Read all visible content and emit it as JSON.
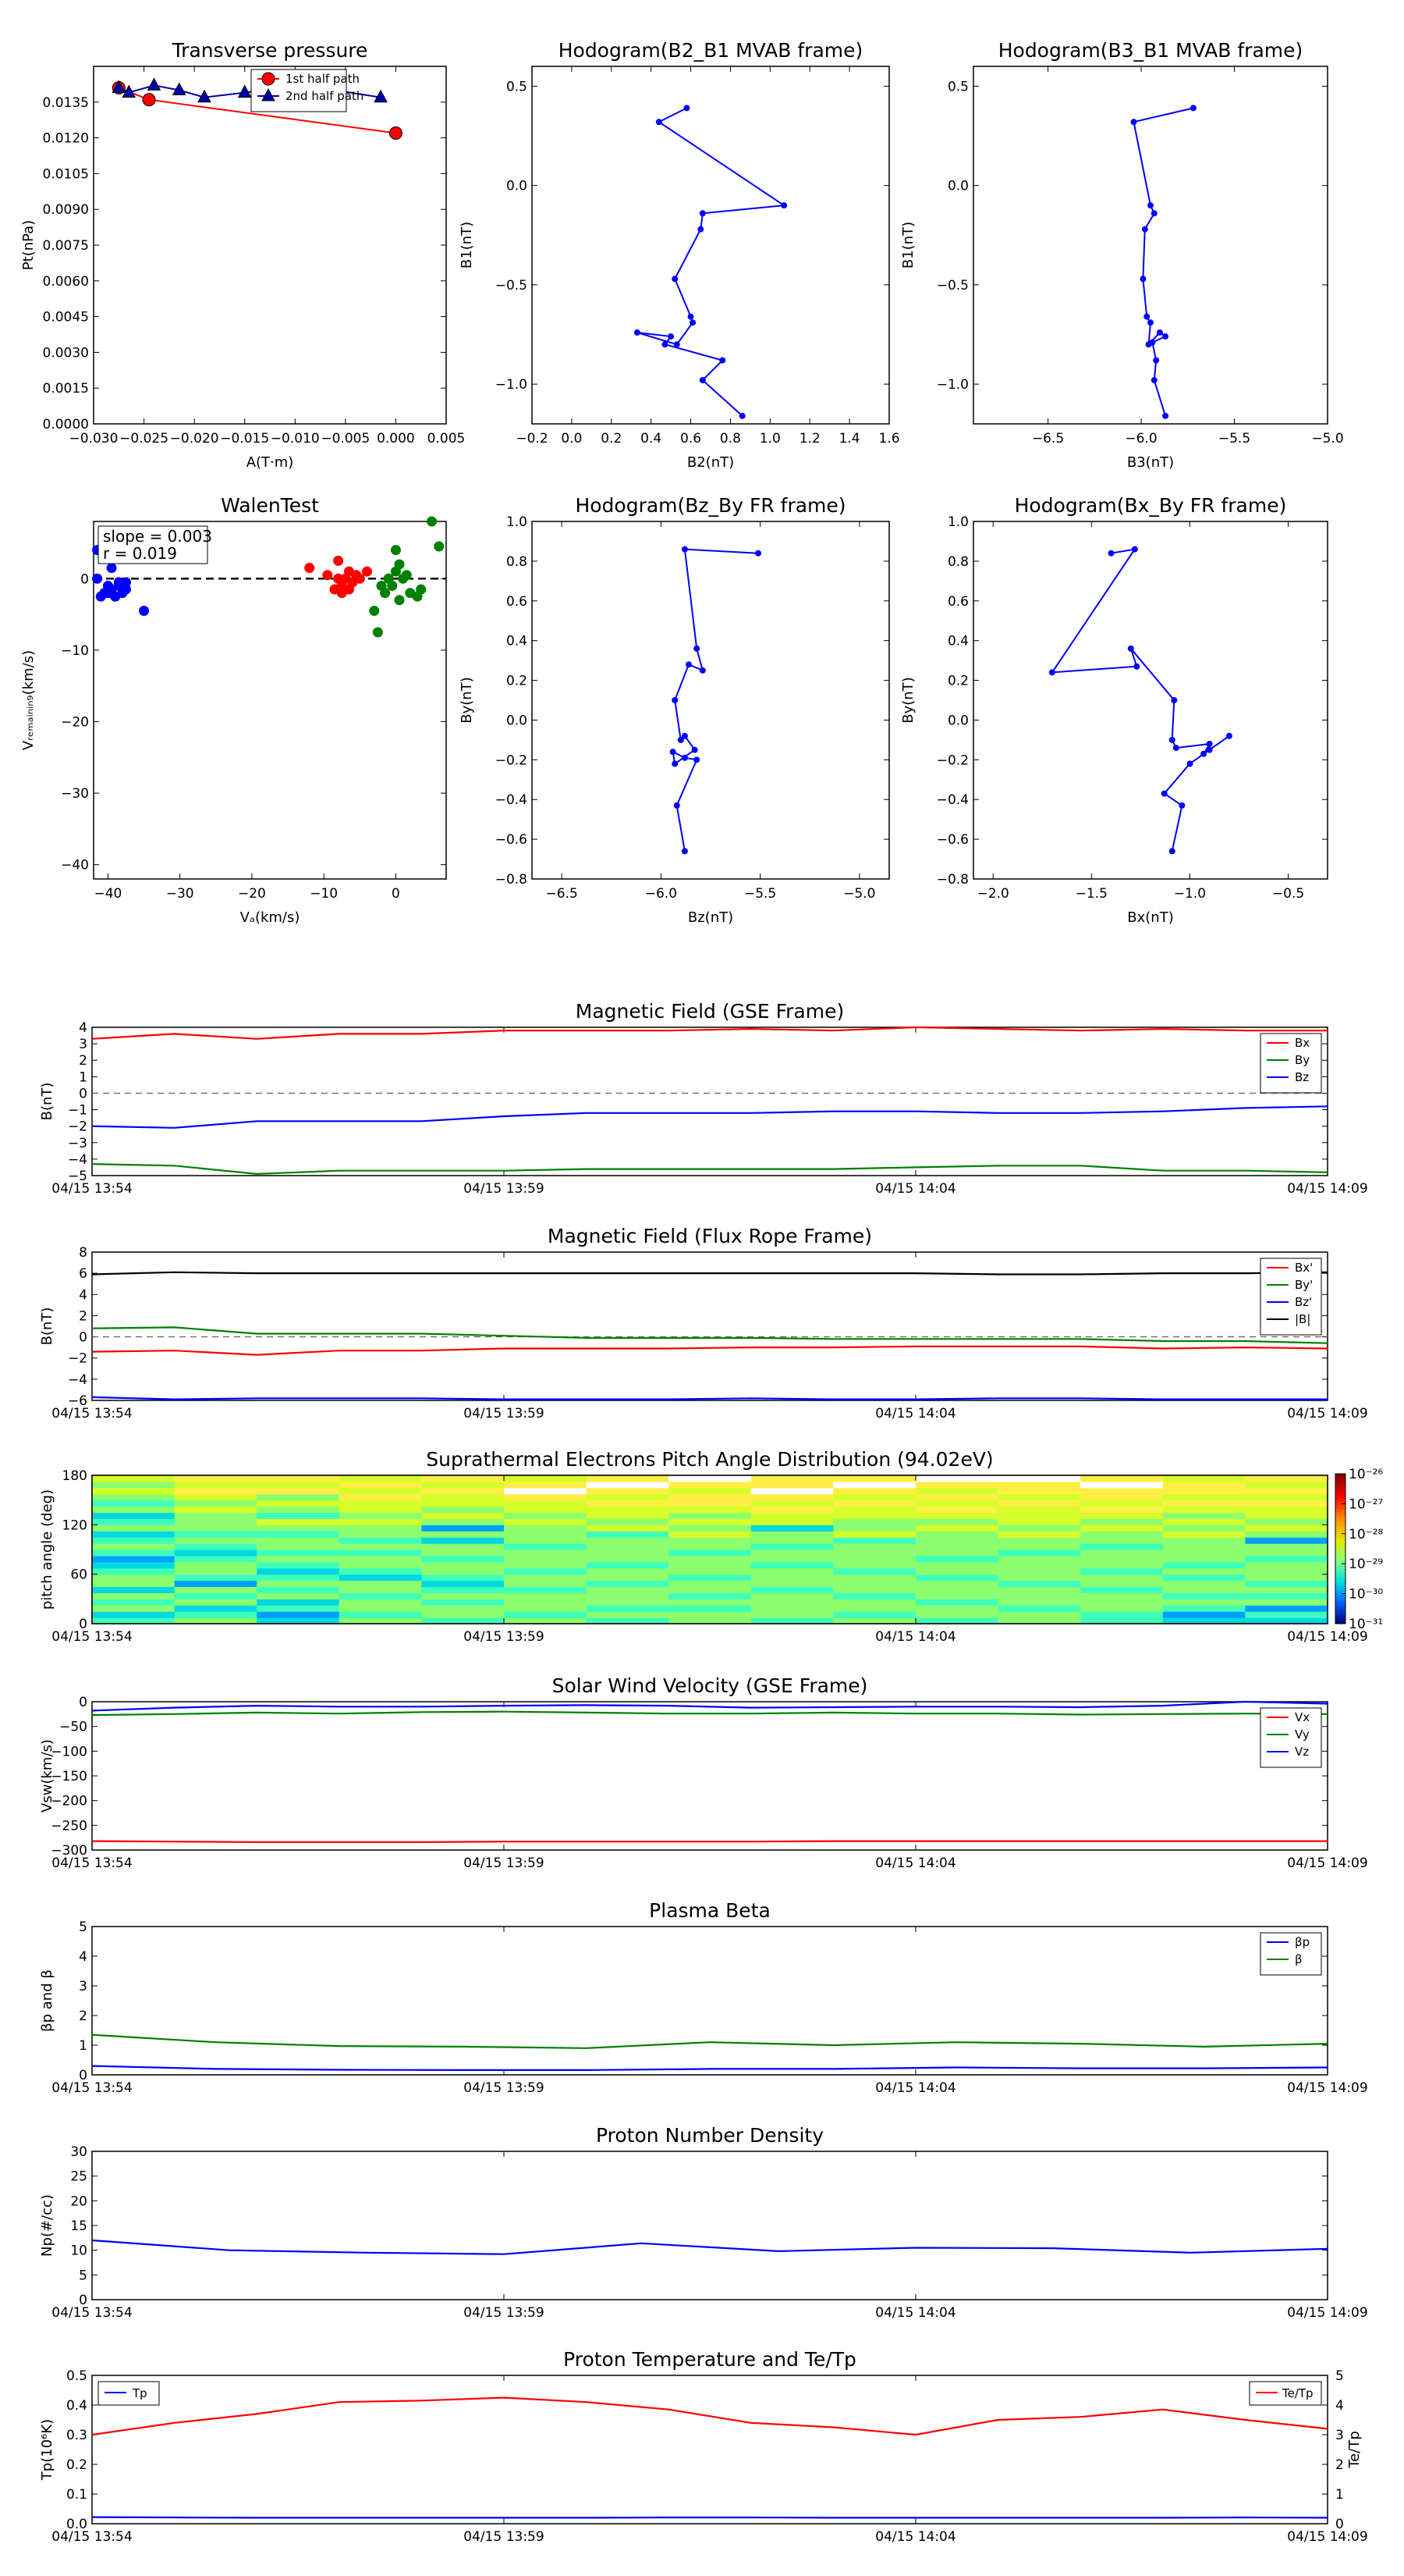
{
  "chart_data": [
    {
      "type": "line",
      "title": "Transverse pressure",
      "xlabel": "A(T·m)",
      "ylabel": "Pt(nPa)",
      "xlim": [
        -0.03,
        0.005
      ],
      "ylim": [
        0,
        0.015
      ],
      "xticks": [
        "−0.030",
        "−0.025",
        "−0.020",
        "−0.015",
        "−0.010",
        "−0.005",
        "0.000",
        "0.005"
      ],
      "yticks": [
        "0.0000",
        "0.0015",
        "0.0030",
        "0.0045",
        "0.0060",
        "0.0075",
        "0.0090",
        "0.0105",
        "0.0120",
        "0.0135"
      ],
      "legend": "top-right",
      "series": [
        {
          "name": "1st half path",
          "color": "#ff0000",
          "marker": "circle",
          "x": [
            0.0,
            -0.0245,
            -0.0275
          ],
          "y": [
            0.0122,
            0.0136,
            0.0141
          ]
        },
        {
          "name": "2nd half path",
          "color": "#0000aa",
          "marker": "triangle",
          "x": [
            -0.0275,
            -0.0265,
            -0.024,
            -0.0215,
            -0.019,
            -0.015,
            -0.0115,
            -0.0075,
            -0.0015
          ],
          "y": [
            0.0141,
            0.0139,
            0.0142,
            0.014,
            0.0137,
            0.0139,
            0.0141,
            0.0141,
            0.0137
          ]
        }
      ]
    },
    {
      "type": "line",
      "title": "Hodogram(B2_B1 MVAB frame)",
      "xlabel": "B2(nT)",
      "ylabel": "B1(nT)",
      "xlim": [
        -0.2,
        1.6
      ],
      "ylim": [
        -1.2,
        0.6
      ],
      "xticks": [
        "−0.2",
        "0.0",
        "0.2",
        "0.4",
        "0.6",
        "0.8",
        "1.0",
        "1.2",
        "1.4",
        "1.6"
      ],
      "yticks": [
        "−1.0",
        "−0.5",
        "0.0",
        "0.5"
      ],
      "series": [
        {
          "color": "#0000ff",
          "x": [
            0.58,
            0.44,
            1.07,
            0.66,
            0.65,
            0.52,
            0.6,
            0.61,
            0.53,
            0.33,
            0.5,
            0.47,
            0.76,
            0.66,
            0.86
          ],
          "y": [
            0.39,
            0.32,
            -0.1,
            -0.14,
            -0.22,
            -0.47,
            -0.66,
            -0.69,
            -0.8,
            -0.74,
            -0.76,
            -0.8,
            -0.88,
            -0.98,
            -1.16
          ]
        }
      ]
    },
    {
      "type": "line",
      "title": "Hodogram(B3_B1 MVAB frame)",
      "xlabel": "B3(nT)",
      "ylabel": "B1(nT)",
      "xlim": [
        -6.9,
        -5.0
      ],
      "ylim": [
        -1.2,
        0.6
      ],
      "xticks": [
        "−6.5",
        "−6.0",
        "−5.5",
        "−5.0"
      ],
      "yticks": [
        "−1.0",
        "−0.5",
        "0.0",
        "0.5"
      ],
      "series": [
        {
          "color": "#0000ff",
          "x": [
            -5.72,
            -6.04,
            -5.95,
            -5.93,
            -5.98,
            -5.99,
            -5.97,
            -5.95,
            -5.96,
            -5.9,
            -5.87,
            -5.94,
            -5.92,
            -5.93,
            -5.87
          ],
          "y": [
            0.39,
            0.32,
            -0.1,
            -0.14,
            -0.22,
            -0.47,
            -0.66,
            -0.69,
            -0.8,
            -0.74,
            -0.76,
            -0.79,
            -0.88,
            -0.98,
            -1.16
          ]
        }
      ]
    },
    {
      "type": "scatter",
      "title": "WalenTest",
      "xlabel": "Vₐ(km/s)",
      "ylabel": "Vᵣₑₘₐᵢₙᵢₙ₉(km/s)",
      "xlim": [
        -42,
        7
      ],
      "ylim": [
        -42,
        8
      ],
      "xticks": [
        "−40",
        "−30",
        "−20",
        "−10",
        "0"
      ],
      "yticks": [
        "−40",
        "−30",
        "−20",
        "−10",
        "0"
      ],
      "annotation": [
        "slope = 0.003",
        "r = 0.019"
      ],
      "series": [
        {
          "color": "#0000ff",
          "x": [
            -41.5,
            -40,
            -40,
            -39.5,
            -39,
            -38.5,
            -38,
            -37.5,
            -41,
            -40.5,
            -39.5,
            -38.5,
            -35,
            -40.5,
            -39,
            -37.5,
            -41.5
          ],
          "y": [
            0,
            -1,
            -2,
            -1.5,
            -2.5,
            -1,
            -2,
            -0.5,
            -2.5,
            -2,
            1.5,
            -0.5,
            -4.5,
            3,
            -2.5,
            -1.5,
            4
          ]
        },
        {
          "color": "#ff0000",
          "x": [
            -12,
            -9.5,
            -8,
            -7.5,
            -7,
            -6.5,
            -6,
            -5,
            -4,
            -8.5,
            -6.5,
            -7.5,
            -5.5,
            -8
          ],
          "y": [
            1.5,
            0.5,
            2.5,
            -1,
            0,
            1,
            -0.5,
            0,
            1,
            -1.5,
            -1.5,
            -2,
            0.5,
            0
          ]
        },
        {
          "color": "#008000",
          "x": [
            -3,
            -2.5,
            -1.5,
            -1,
            -0.5,
            0,
            0.5,
            1,
            2,
            3,
            3.5,
            5,
            6,
            -2,
            0,
            1.5,
            0.5,
            -1
          ],
          "y": [
            -4.5,
            -7.5,
            -2,
            0,
            -1,
            4,
            2,
            0,
            -2,
            -2.5,
            -1.5,
            8,
            4.5,
            -1,
            1,
            0.5,
            -3,
            0
          ]
        }
      ]
    },
    {
      "type": "line",
      "title": "Hodogram(Bz_By FR frame)",
      "xlabel": "Bz(nT)",
      "ylabel": "By(nT)",
      "xlim": [
        -6.65,
        -4.85
      ],
      "ylim": [
        -0.8,
        1.0
      ],
      "xticks": [
        "−6.5",
        "−6.0",
        "−5.5",
        "−5.0"
      ],
      "yticks": [
        "−0.8",
        "−0.6",
        "−0.4",
        "−0.2",
        "0.0",
        "0.2",
        "0.4",
        "0.6",
        "0.8",
        "1.0"
      ],
      "series": [
        {
          "color": "#0000ff",
          "x": [
            -5.51,
            -5.88,
            -5.82,
            -5.79,
            -5.86,
            -5.93,
            -5.9,
            -5.88,
            -5.83,
            -5.93,
            -5.94,
            -5.88,
            -5.82,
            -5.92,
            -5.88
          ],
          "y": [
            0.84,
            0.86,
            0.36,
            0.25,
            0.28,
            0.1,
            -0.1,
            -0.08,
            -0.15,
            -0.22,
            -0.16,
            -0.19,
            -0.2,
            -0.43,
            -0.66
          ]
        }
      ]
    },
    {
      "type": "line",
      "title": "Hodogram(Bx_By FR frame)",
      "xlabel": "Bx(nT)",
      "ylabel": "By(nT)",
      "xlim": [
        -2.1,
        -0.3
      ],
      "ylim": [
        -0.8,
        1.0
      ],
      "xticks": [
        "−2.0",
        "−1.5",
        "−1.0",
        "−0.5"
      ],
      "yticks": [
        "−0.8",
        "−0.6",
        "−0.4",
        "−0.2",
        "0.0",
        "0.2",
        "0.4",
        "0.6",
        "0.8",
        "1.0"
      ],
      "series": [
        {
          "color": "#0000ff",
          "x": [
            -1.4,
            -1.28,
            -1.7,
            -1.27,
            -1.3,
            -1.08,
            -1.09,
            -1.07,
            -0.9,
            -0.93,
            -0.8,
            -0.9,
            -1.0,
            -1.13,
            -1.04,
            -1.09
          ],
          "y": [
            0.84,
            0.86,
            0.24,
            0.27,
            0.36,
            0.1,
            -0.1,
            -0.14,
            -0.12,
            -0.17,
            -0.08,
            -0.15,
            -0.22,
            -0.37,
            -0.43,
            -0.66
          ]
        }
      ]
    },
    {
      "type": "line",
      "title": "Magnetic Field (GSE Frame)",
      "ylabel": "B(nT)",
      "ylim": [
        -5,
        4
      ],
      "yticks": [
        "−5",
        "−4",
        "−3",
        "−2",
        "−1",
        "0",
        "1",
        "2",
        "3",
        "4"
      ],
      "xticks": [
        "04/15 13:54",
        "04/15 13:59",
        "04/15 14:04",
        "04/15 14:09"
      ],
      "legend": "top-right",
      "hline": 0,
      "series": [
        {
          "name": "Bx",
          "color": "#ff0000",
          "values": [
            3.3,
            3.6,
            3.3,
            3.6,
            3.6,
            3.8,
            3.8,
            3.8,
            3.9,
            3.8,
            4.0,
            3.9,
            3.8,
            3.9,
            3.8,
            3.8
          ]
        },
        {
          "name": "By",
          "color": "#008000",
          "values": [
            -4.3,
            -4.4,
            -4.9,
            -4.7,
            -4.7,
            -4.7,
            -4.6,
            -4.6,
            -4.6,
            -4.6,
            -4.5,
            -4.4,
            -4.4,
            -4.7,
            -4.7,
            -4.8
          ]
        },
        {
          "name": "Bz",
          "color": "#0000ff",
          "values": [
            -2.0,
            -2.1,
            -1.7,
            -1.7,
            -1.7,
            -1.4,
            -1.2,
            -1.2,
            -1.2,
            -1.1,
            -1.1,
            -1.2,
            -1.2,
            -1.1,
            -0.9,
            -0.8
          ]
        }
      ]
    },
    {
      "type": "line",
      "title": "Magnetic Field (Flux Rope Frame)",
      "ylabel": "B(nT)",
      "ylim": [
        -6,
        8
      ],
      "yticks": [
        "−6",
        "−4",
        "−2",
        "0",
        "2",
        "4",
        "6",
        "8"
      ],
      "xticks": [
        "04/15 13:54",
        "04/15 13:59",
        "04/15 14:04",
        "04/15 14:09"
      ],
      "legend": "top-right",
      "hline": 0,
      "series": [
        {
          "name": "Bx'",
          "color": "#ff0000",
          "values": [
            -1.4,
            -1.3,
            -1.7,
            -1.3,
            -1.3,
            -1.1,
            -1.1,
            -1.1,
            -1.0,
            -1.0,
            -0.9,
            -0.9,
            -0.9,
            -1.1,
            -1.0,
            -1.1
          ]
        },
        {
          "name": "By'",
          "color": "#008000",
          "values": [
            0.8,
            0.9,
            0.3,
            0.3,
            0.3,
            0.1,
            -0.1,
            -0.1,
            -0.1,
            -0.2,
            -0.2,
            -0.2,
            -0.2,
            -0.4,
            -0.4,
            -0.6
          ]
        },
        {
          "name": "Bz'",
          "color": "#0000ff",
          "values": [
            -5.7,
            -5.9,
            -5.8,
            -5.8,
            -5.8,
            -5.9,
            -5.9,
            -5.9,
            -5.8,
            -5.9,
            -5.9,
            -5.8,
            -5.8,
            -5.9,
            -5.9,
            -5.9
          ]
        },
        {
          "name": "|B|",
          "color": "#000000",
          "values": [
            5.9,
            6.1,
            6.0,
            6.0,
            6.0,
            6.0,
            6.0,
            6.0,
            6.0,
            6.0,
            6.0,
            5.9,
            5.9,
            6.0,
            6.0,
            6.1
          ]
        }
      ]
    },
    {
      "type": "heatmap",
      "title": "Suprathermal Electrons Pitch Angle Distribution (94.02eV)",
      "ylabel": "pitch angle (deg)",
      "ylim": [
        0,
        180
      ],
      "yticks": [
        "0",
        "60",
        "120",
        "180"
      ],
      "xticks": [
        "04/15 13:54",
        "04/15 13:59",
        "04/15 14:04",
        "04/15 14:09"
      ],
      "colorbar_ticks": [
        "10⁻²⁶",
        "10⁻²⁷",
        "10⁻²⁸",
        "10⁻²⁹",
        "10⁻³⁰",
        "10⁻³¹"
      ],
      "colors": [
        "#ffffff",
        "#ffee44",
        "#d4ff2a",
        "#8cff6e",
        "#3dffba",
        "#00d8e0",
        "#00a0ff"
      ]
    },
    {
      "type": "line",
      "title": "Solar Wind Velocity (GSE Frame)",
      "ylabel": "Vsw(km/s)",
      "ylim": [
        -300,
        0
      ],
      "yticks": [
        "−300",
        "−250",
        "−200",
        "−150",
        "−100",
        "−50",
        "0"
      ],
      "xticks": [
        "04/15 13:54",
        "04/15 13:59",
        "04/15 14:04",
        "04/15 14:09"
      ],
      "legend": "top-right",
      "series": [
        {
          "name": "Vx",
          "color": "#ff0000",
          "values": [
            -282,
            -283,
            -284,
            -284,
            -284,
            -283,
            -283,
            -283,
            -283,
            -282,
            -282,
            -282,
            -282,
            -282,
            -282,
            -282
          ]
        },
        {
          "name": "Vy",
          "color": "#008000",
          "values": [
            -27,
            -25,
            -22,
            -24,
            -21,
            -20,
            -22,
            -24,
            -24,
            -22,
            -24,
            -24,
            -26,
            -25,
            -24,
            -25
          ]
        },
        {
          "name": "Vz",
          "color": "#0000ff",
          "values": [
            -18,
            -12,
            -8,
            -10,
            -10,
            -8,
            -7,
            -8,
            -12,
            -11,
            -10,
            -10,
            -11,
            -8,
            0,
            -4
          ]
        }
      ]
    },
    {
      "type": "line",
      "title": "Plasma Beta",
      "ylabel": "βp and β",
      "ylim": [
        0,
        5
      ],
      "yticks": [
        "0",
        "1",
        "2",
        "3",
        "4",
        "5"
      ],
      "xticks": [
        "04/15 13:54",
        "04/15 13:59",
        "04/15 14:04",
        "04/15 14:09"
      ],
      "legend": "top-right",
      "series": [
        {
          "name": "βp",
          "color": "#0000ff",
          "values": [
            0.3,
            0.2,
            0.17,
            0.16,
            0.16,
            0.2,
            0.2,
            0.25,
            0.22,
            0.22,
            0.25
          ]
        },
        {
          "name": "β",
          "color": "#008000",
          "values": [
            1.35,
            1.1,
            0.97,
            0.95,
            0.9,
            1.1,
            1.0,
            1.1,
            1.05,
            0.95,
            1.05
          ]
        }
      ]
    },
    {
      "type": "line",
      "title": "Proton Number Density",
      "ylabel": "Np(#/cc)",
      "ylim": [
        0,
        30
      ],
      "yticks": [
        "0",
        "5",
        "10",
        "15",
        "20",
        "25",
        "30"
      ],
      "xticks": [
        "04/15 13:54",
        "04/15 13:59",
        "04/15 14:04",
        "04/15 14:09"
      ],
      "series": [
        {
          "name": "Np",
          "color": "#0000ff",
          "values": [
            12.0,
            10.0,
            9.5,
            9.2,
            11.4,
            9.8,
            10.5,
            10.4,
            9.5,
            10.3
          ]
        }
      ]
    },
    {
      "type": "line",
      "title": "Proton Temperature and Te/Tp",
      "ylabel": "Tp(10⁶K)",
      "y2label": "Te/Tp",
      "ylim": [
        0,
        0.5
      ],
      "y2lim": [
        0,
        5
      ],
      "yticks": [
        "0.0",
        "0.1",
        "0.2",
        "0.3",
        "0.4",
        "0.5"
      ],
      "y2ticks": [
        "0",
        "1",
        "2",
        "3",
        "4",
        "5"
      ],
      "xticks": [
        "04/15 13:54",
        "04/15 13:59",
        "04/15 14:04",
        "04/15 14:09"
      ],
      "series": [
        {
          "name": "Tp",
          "color": "#0000ff",
          "axis": "left",
          "values": [
            0.022,
            0.021,
            0.02,
            0.02,
            0.02,
            0.02,
            0.02,
            0.021,
            0.021,
            0.02,
            0.02,
            0.02,
            0.02,
            0.02,
            0.021,
            0.02
          ]
        },
        {
          "name": "Te/Tp",
          "color": "#ff0000",
          "axis": "right",
          "values": [
            3.0,
            3.4,
            3.7,
            4.1,
            4.15,
            4.25,
            4.1,
            3.85,
            3.4,
            3.25,
            3.0,
            3.5,
            3.6,
            3.85,
            3.5,
            3.2
          ]
        }
      ]
    }
  ]
}
